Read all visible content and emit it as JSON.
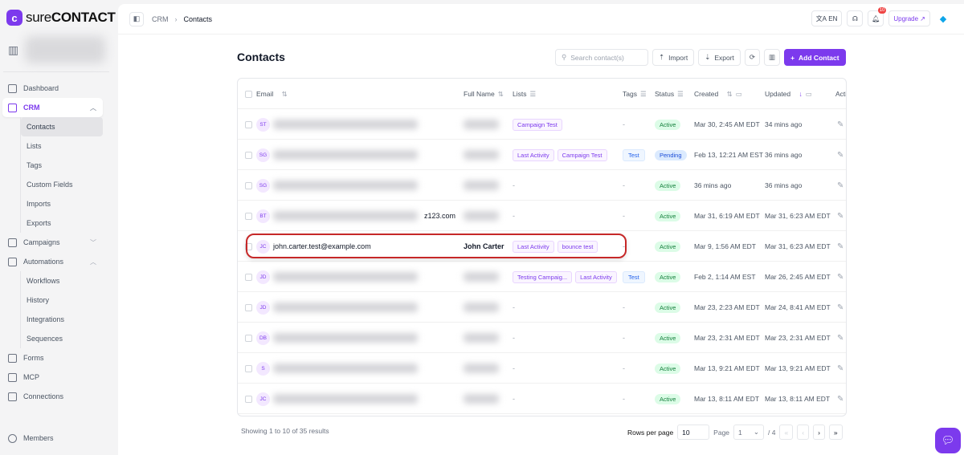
{
  "app": {
    "logo_sure": "sure",
    "logo_contact": "CONTACT"
  },
  "sidebar": {
    "items": [
      {
        "label": "Dashboard",
        "icon": "dashboard-icon"
      },
      {
        "label": "CRM",
        "icon": "crm-icon",
        "expanded": true,
        "children": [
          "Contacts",
          "Lists",
          "Tags",
          "Custom Fields",
          "Imports",
          "Exports"
        ],
        "current": "Contacts"
      },
      {
        "label": "Campaigns",
        "icon": "campaigns-icon",
        "expanded": false
      },
      {
        "label": "Automations",
        "icon": "automations-icon",
        "expanded": true,
        "children": [
          "Workflows",
          "History",
          "Integrations",
          "Sequences"
        ]
      },
      {
        "label": "Forms",
        "icon": "forms-icon"
      },
      {
        "label": "MCP",
        "icon": "mcp-icon"
      },
      {
        "label": "Connections",
        "icon": "connections-icon"
      }
    ],
    "bottom": "Members"
  },
  "header": {
    "breadcrumb": [
      "CRM",
      "Contacts"
    ],
    "lang": "EN",
    "notifications": "10",
    "upgrade": "Upgrade"
  },
  "page": {
    "title": "Contacts",
    "search_placeholder": "Search contact(s)",
    "import": "Import",
    "export": "Export",
    "add": "Add Contact"
  },
  "table": {
    "columns": {
      "email": "Email",
      "fullname": "Full Name",
      "lists": "Lists",
      "tags": "Tags",
      "status": "Status",
      "created": "Created",
      "updated": "Updated",
      "actions": "Acti"
    },
    "rows": [
      {
        "initials": "ST",
        "email": "",
        "name": "",
        "lists": [
          "Campaign Test"
        ],
        "tags": [],
        "status": "Active",
        "created": "Mar 30, 2:45 AM EDT",
        "updated": "34 mins ago"
      },
      {
        "initials": "SG",
        "email": "",
        "name": "",
        "lists": [
          "Last Activity",
          "Campaign Test"
        ],
        "tags": [
          "Test"
        ],
        "status": "Pending",
        "created": "Feb 13, 12:21 AM EST",
        "updated": "36 mins ago"
      },
      {
        "initials": "SG",
        "email": "",
        "name": "",
        "lists": [],
        "tags": [],
        "status": "Active",
        "created": "36 mins ago",
        "updated": "36 mins ago"
      },
      {
        "initials": "BT",
        "email": "z123.com",
        "name": "",
        "lists": [],
        "tags": [],
        "status": "Active",
        "created": "Mar 31, 6:19 AM EDT",
        "updated": "Mar 31, 6:23 AM EDT"
      },
      {
        "initials": "JC",
        "email": "john.carter.test@example.com",
        "name": "John Carter",
        "lists": [
          "Last Activity",
          "bounce test"
        ],
        "tags": [],
        "status": "Active",
        "created": "Mar 9, 1:56 AM EDT",
        "updated": "Mar 31, 6:23 AM EDT",
        "highlighted": true
      },
      {
        "initials": "JD",
        "email": "",
        "name": "",
        "lists": [
          "Testing Campaig...",
          "Last Activity"
        ],
        "tags": [
          "Test"
        ],
        "status": "Active",
        "created": "Feb 2, 1:14 AM EST",
        "updated": "Mar 26, 2:45 AM EDT"
      },
      {
        "initials": "JD",
        "email": "",
        "name": "",
        "lists": [],
        "tags": [],
        "status": "Active",
        "created": "Mar 23, 2:23 AM EDT",
        "updated": "Mar 24, 8:41 AM EDT"
      },
      {
        "initials": "DB",
        "email": "",
        "name": "",
        "lists": [],
        "tags": [],
        "status": "Active",
        "created": "Mar 23, 2:31 AM EDT",
        "updated": "Mar 23, 2:31 AM EDT"
      },
      {
        "initials": "S",
        "email": "",
        "name": "",
        "lists": [],
        "tags": [],
        "status": "Active",
        "created": "Mar 13, 9:21 AM EDT",
        "updated": "Mar 13, 9:21 AM EDT"
      },
      {
        "initials": "JC",
        "email": "",
        "name": "",
        "lists": [],
        "tags": [],
        "status": "Active",
        "created": "Mar 13, 8:11 AM EDT",
        "updated": "Mar 13, 8:11 AM EDT"
      }
    ]
  },
  "footer": {
    "showing": "Showing 1 to 10 of 35 results",
    "rows_label": "Rows per page",
    "rows_value": "10",
    "page_label": "Page",
    "page_value": "1",
    "page_total": "/ 4"
  },
  "colors": {
    "accent": "#7c3aed",
    "highlight": "#c62828"
  }
}
